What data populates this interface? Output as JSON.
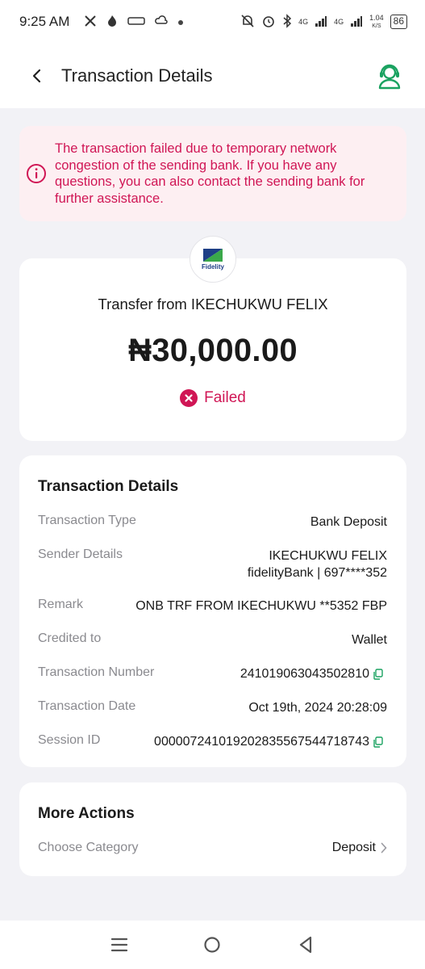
{
  "status_bar": {
    "time": "9:25 AM",
    "battery": "86",
    "net_speed_value": "1.04",
    "net_speed_unit": "K/S",
    "signal_label_1": "4G",
    "signal_label_2": "4G"
  },
  "header": {
    "title": "Transaction Details"
  },
  "alert": {
    "message": "The transaction failed due to temporary network congestion of the sending bank. If you have any questions, you can also contact the sending bank for further assistance."
  },
  "summary": {
    "bank_logo_text": "Fidelity",
    "title": "Transfer from IKECHUKWU FELIX",
    "amount": "₦30,000.00",
    "status": "Failed"
  },
  "details": {
    "section_title": "Transaction Details",
    "transaction_type_label": "Transaction Type",
    "transaction_type_value": "Bank Deposit",
    "sender_label": "Sender Details",
    "sender_name": "IKECHUKWU FELIX",
    "sender_bank": "fidelityBank | 697****352",
    "remark_label": "Remark",
    "remark_value": "ONB TRF FROM IKECHUKWU **5352 FBP",
    "credited_label": "Credited to",
    "credited_value": "Wallet",
    "txn_number_label": "Transaction Number",
    "txn_number_value": "241019063043502810",
    "txn_date_label": "Transaction Date",
    "txn_date_value": "Oct 19th, 2024 20:28:09",
    "session_label": "Session ID",
    "session_value": "000007241019202835567544718743"
  },
  "actions": {
    "section_title": "More Actions",
    "category_label": "Choose Category",
    "category_value": "Deposit"
  },
  "colors": {
    "accent_green": "#1aa260",
    "error_red": "#d01655",
    "alert_bg": "#fdeff2"
  }
}
